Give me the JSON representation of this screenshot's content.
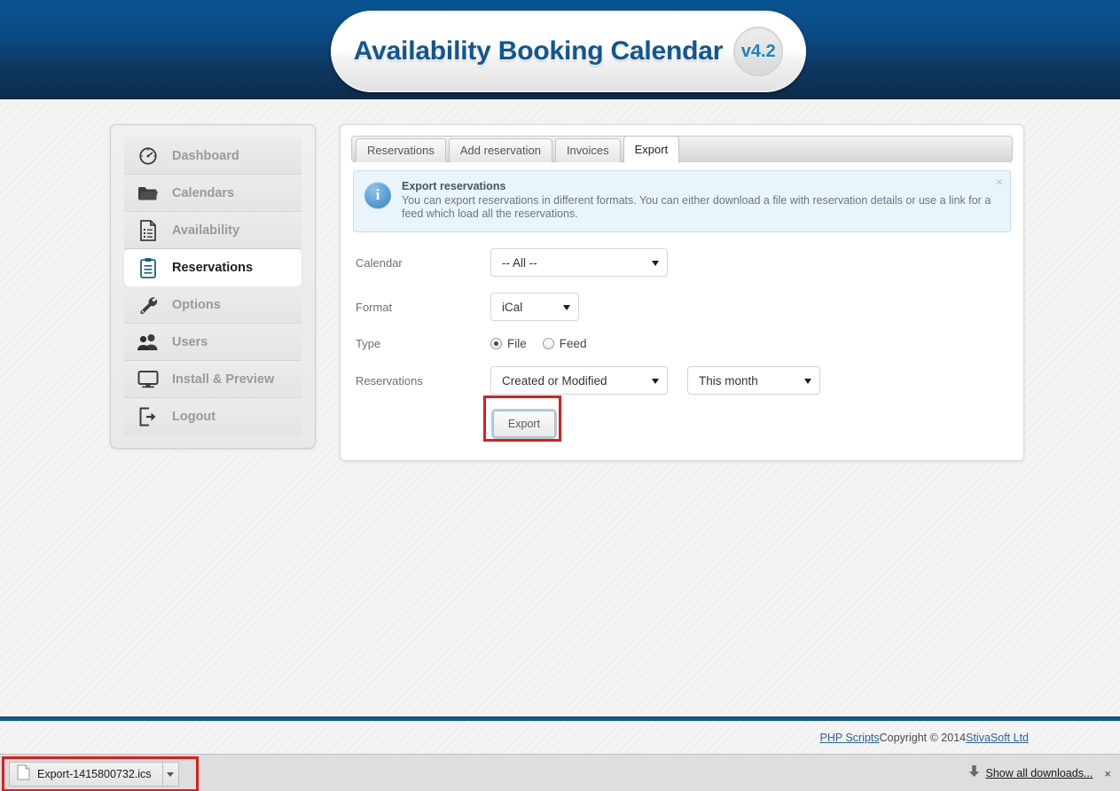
{
  "header": {
    "title": "Availability Booking Calendar",
    "version": "v4.2"
  },
  "sidebar": {
    "items": [
      {
        "label": "Dashboard",
        "icon": "gauge-icon",
        "active": false
      },
      {
        "label": "Calendars",
        "icon": "folder-icon",
        "active": false
      },
      {
        "label": "Availability",
        "icon": "document-list-icon",
        "active": false
      },
      {
        "label": "Reservations",
        "icon": "clipboard-icon",
        "active": true
      },
      {
        "label": "Options",
        "icon": "wrench-icon",
        "active": false
      },
      {
        "label": "Users",
        "icon": "users-icon",
        "active": false
      },
      {
        "label": "Install & Preview",
        "icon": "monitor-icon",
        "active": false
      },
      {
        "label": "Logout",
        "icon": "logout-icon",
        "active": false
      }
    ]
  },
  "main": {
    "tabs": [
      {
        "label": "Reservations",
        "active": false
      },
      {
        "label": "Add reservation",
        "active": false
      },
      {
        "label": "Invoices",
        "active": false
      },
      {
        "label": "Export",
        "active": true
      }
    ],
    "info": {
      "icon": "info-icon",
      "title": "Export reservations",
      "text": "You can export reservations in different formats. You can either download a file with reservation details or use a link for a feed which load all the reservations.",
      "close_label": "×"
    },
    "form": {
      "calendar_label": "Calendar",
      "calendar_value": "-- All --",
      "format_label": "Format",
      "format_value": "iCal",
      "type_label": "Type",
      "type_file_label": "File",
      "type_feed_label": "Feed",
      "type_selected": "File",
      "reservations_label": "Reservations",
      "reservations_value": "Created or Modified",
      "period_value": "This month",
      "export_button": "Export"
    }
  },
  "footer": {
    "link1": "PHP Scripts",
    "copyright": " Copyright © 2014 ",
    "link2": "StivaSoft Ltd"
  },
  "download_bar": {
    "file_icon": "file-icon",
    "filename": "Export-1415800732.ics",
    "caret": "chevron-down-icon",
    "show_all_label": "Show all downloads...",
    "close_label": "×"
  },
  "colors": {
    "header_top": "#0a5493",
    "header_bottom": "#0c2b4a",
    "brand_blue": "#12568f",
    "version_blue": "#1b7fc4",
    "accent_rule": "#15578f",
    "annotation_red": "#e01b1b",
    "info_bg": "#eaf4fb",
    "link": "#2a6496"
  }
}
